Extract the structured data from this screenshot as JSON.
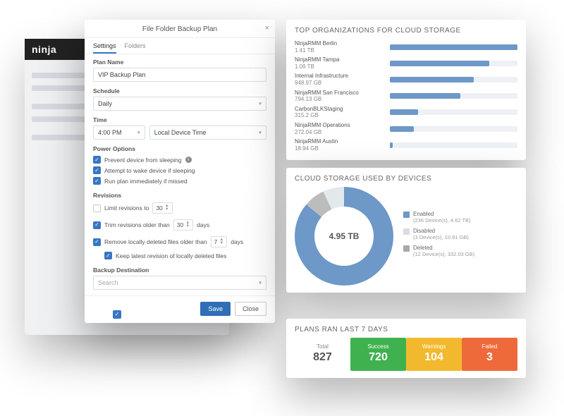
{
  "brand": "ninja",
  "modal": {
    "title": "File Folder Backup Plan",
    "close": "×",
    "tabs": {
      "settings": "Settings",
      "folders": "Folders"
    },
    "plan_name": {
      "label": "Plan Name",
      "value": "VIP Backup Plan"
    },
    "schedule": {
      "label": "Schedule",
      "value": "Daily"
    },
    "time": {
      "label": "Time",
      "value": "4:00 PM",
      "tz": "Local Device Time"
    },
    "power": {
      "label": "Power Options",
      "opt1": "Prevent device from sleeping",
      "opt2": "Attempt to wake device if sleeping",
      "opt3": "Run plan immediately if missed"
    },
    "revisions": {
      "label": "Revisions",
      "limit_label": "Limit revisions to",
      "limit_value": "30",
      "trim_label": "Trim revisions older than",
      "trim_value": "30",
      "trim_unit": "days",
      "removeLocal_label": "Remove locally deleted files older than",
      "removeLocal_value": "7",
      "removeLocal_unit": "days",
      "keep_label": "Keep latest revision of locally deleted files"
    },
    "dest": {
      "label": "Backup Destination",
      "placeholder": "Search"
    },
    "buttons": {
      "save": "Save",
      "close": "Close"
    }
  },
  "orgs": {
    "title": "TOP ORGANIZATIONS FOR CLOUD STORAGE",
    "items": [
      {
        "name": "NinjaRMM Berlin",
        "size": "1.41 TB",
        "pct": 100
      },
      {
        "name": "NinjaRMM Tampa",
        "size": "1.09 TB",
        "pct": 78
      },
      {
        "name": "Internal Infrastructure",
        "size": "948.97 GB",
        "pct": 66
      },
      {
        "name": "NinjaRMM San Francisco",
        "size": "794.13 GB",
        "pct": 55
      },
      {
        "name": "CarbonBLKStaging",
        "size": "315.2 GB",
        "pct": 22
      },
      {
        "name": "NinjaRMM Operations",
        "size": "272.04 GB",
        "pct": 19
      },
      {
        "name": "NinjaRMM Austin",
        "size": "18.94 GB",
        "pct": 2
      }
    ]
  },
  "donut": {
    "title": "CLOUD STORAGE USED BY DEVICES",
    "center": "4.95 TB",
    "legend": [
      {
        "label": "Enabled",
        "detail": "(236 Device(s), 4.62 TB)",
        "color": "#6d98c7"
      },
      {
        "label": "Disabled",
        "detail": "(3 Device(s), 10.91 GB)",
        "color": "#d8dde3"
      },
      {
        "label": "Deleted",
        "detail": "(12 Device(s), 332.03 GB)",
        "color": "#a9a9a9"
      }
    ]
  },
  "plans": {
    "title": "PLANS RAN LAST 7 DAYS",
    "cells": [
      {
        "label": "Total",
        "value": "827",
        "bg": "#ffffff"
      },
      {
        "label": "Success",
        "value": "720",
        "bg": "#3fb24f"
      },
      {
        "label": "Warnings",
        "value": "104",
        "bg": "#f3b92e"
      },
      {
        "label": "Failed",
        "value": "3",
        "bg": "#ee6a3a"
      }
    ]
  },
  "chart_data": [
    {
      "type": "bar",
      "title": "TOP ORGANIZATIONS FOR CLOUD STORAGE",
      "categories": [
        "NinjaRMM Berlin",
        "NinjaRMM Tampa",
        "Internal Infrastructure",
        "NinjaRMM San Francisco",
        "CarbonBLKStaging",
        "NinjaRMM Operations",
        "NinjaRMM Austin"
      ],
      "values": [
        1443.84,
        1116.16,
        948.97,
        794.13,
        315.2,
        272.04,
        18.94
      ],
      "ylabel": "GB",
      "xlabel": ""
    },
    {
      "type": "pie",
      "title": "CLOUD STORAGE USED BY DEVICES",
      "categories": [
        "Enabled",
        "Disabled",
        "Deleted"
      ],
      "values": [
        4730.88,
        10.91,
        332.03
      ],
      "ylabel": "GB"
    }
  ]
}
